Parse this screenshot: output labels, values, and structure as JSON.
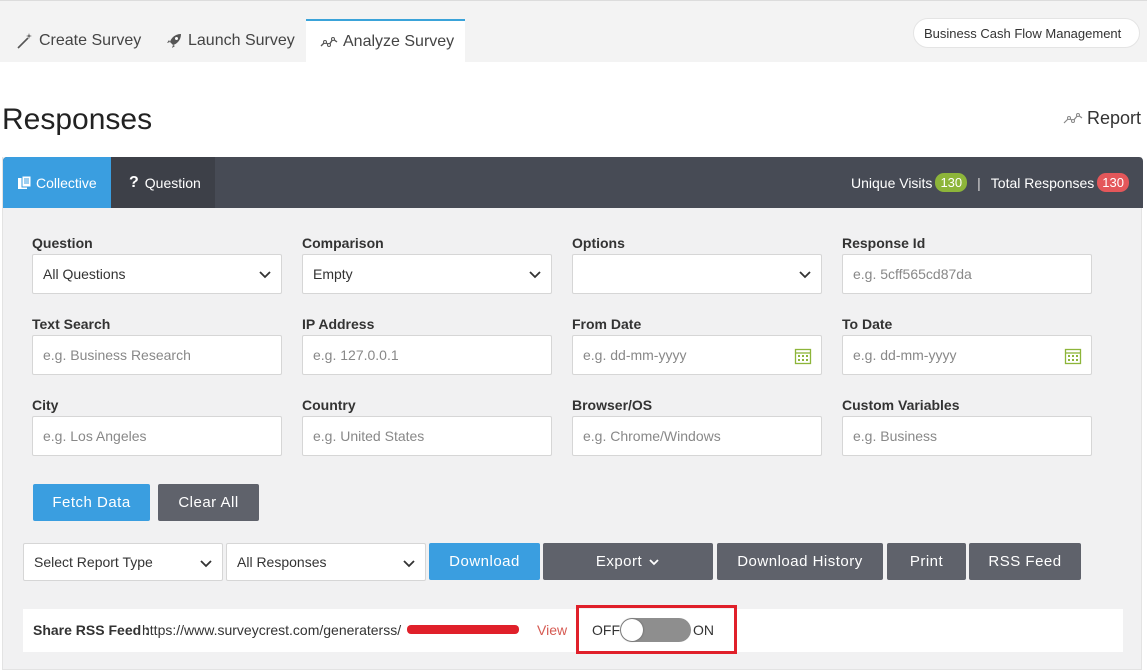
{
  "tabs": [
    {
      "label": "Create Survey",
      "icon": "magic-wand-icon"
    },
    {
      "label": "Launch Survey",
      "icon": "rocket-icon"
    },
    {
      "label": "Analyze Survey",
      "icon": "line-chart-icon"
    }
  ],
  "survey_name": "Business Cash Flow Management",
  "page_title": "Responses",
  "report_link": "Report",
  "panel_tabs": {
    "collective": "Collective",
    "question": "Question"
  },
  "stats": {
    "unique_visits_label": "Unique Visits",
    "unique_visits": "130",
    "total_responses_label": "Total Responses",
    "total_responses": "130",
    "separator": "|"
  },
  "filters": {
    "question": {
      "label": "Question",
      "value": "All Questions"
    },
    "comparison": {
      "label": "Comparison",
      "value": "Empty"
    },
    "options": {
      "label": "Options",
      "value": ""
    },
    "response_id": {
      "label": "Response Id",
      "placeholder": "e.g. 5cff565cd87da"
    },
    "text_search": {
      "label": "Text Search",
      "placeholder": "e.g. Business Research"
    },
    "ip_address": {
      "label": "IP Address",
      "placeholder": "e.g. 127.0.0.1"
    },
    "from_date": {
      "label": "From Date",
      "placeholder": "e.g. dd-mm-yyyy"
    },
    "to_date": {
      "label": "To Date",
      "placeholder": "e.g. dd-mm-yyyy"
    },
    "city": {
      "label": "City",
      "placeholder": "e.g. Los Angeles"
    },
    "country": {
      "label": "Country",
      "placeholder": "e.g. United States"
    },
    "browser_os": {
      "label": "Browser/OS",
      "placeholder": "e.g. Chrome/Windows"
    },
    "custom_variables": {
      "label": "Custom Variables",
      "placeholder": "e.g. Business"
    }
  },
  "buttons": {
    "fetch": "Fetch Data",
    "clear": "Clear All",
    "report_type": "Select Report Type",
    "responses": "All Responses",
    "download": "Download",
    "export": "Export",
    "download_history": "Download History",
    "print": "Print",
    "rss_feed": "RSS Feed"
  },
  "rss": {
    "label": "Share RSS Feed :",
    "url": "https://www.surveycrest.com/generaterss/",
    "view": "View",
    "toggle_off": "OFF",
    "toggle_on": "ON",
    "toggle_state": "off"
  },
  "colors": {
    "accent": "#3a9ee0",
    "panel_header": "#474b55",
    "badge_green": "#8db53a",
    "badge_red": "#e4575a",
    "highlight": "#e0202a"
  }
}
